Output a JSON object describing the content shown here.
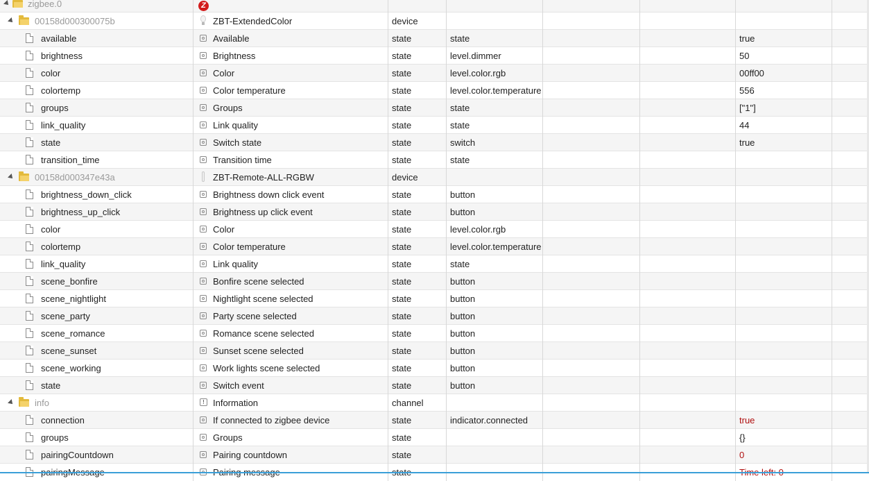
{
  "rows": [
    {
      "id": "zigbee.0",
      "level": 0,
      "kind": "folder",
      "muted": true,
      "icon": "adapter",
      "title": "",
      "type": "",
      "role": "",
      "value": "",
      "buttons": "del"
    },
    {
      "id": "00158d000300075b",
      "level": 1,
      "kind": "folder",
      "muted": true,
      "icon": "bulb",
      "title": "ZBT-ExtendedColor",
      "type": "device",
      "role": "",
      "value": "",
      "buttons": "both"
    },
    {
      "id": "available",
      "level": 2,
      "kind": "file",
      "icon": "state",
      "title": "Available",
      "type": "state",
      "role": "state",
      "value": "true",
      "buttons": "both"
    },
    {
      "id": "brightness",
      "level": 2,
      "kind": "file",
      "icon": "state",
      "title": "Brightness",
      "type": "state",
      "role": "level.dimmer",
      "value": "50",
      "buttons": "both"
    },
    {
      "id": "color",
      "level": 2,
      "kind": "file",
      "icon": "state",
      "title": "Color",
      "type": "state",
      "role": "level.color.rgb",
      "value": "00ff00",
      "buttons": "both"
    },
    {
      "id": "colortemp",
      "level": 2,
      "kind": "file",
      "icon": "state",
      "title": "Color temperature",
      "type": "state",
      "role": "level.color.temperature",
      "value": "556",
      "buttons": "both"
    },
    {
      "id": "groups",
      "level": 2,
      "kind": "file",
      "icon": "state",
      "title": "Groups",
      "type": "state",
      "role": "state",
      "value": "[\"1\"]",
      "buttons": "both"
    },
    {
      "id": "link_quality",
      "level": 2,
      "kind": "file",
      "icon": "state",
      "title": "Link quality",
      "type": "state",
      "role": "state",
      "value": "44",
      "buttons": "both"
    },
    {
      "id": "state",
      "level": 2,
      "kind": "file",
      "icon": "state",
      "title": "Switch state",
      "type": "state",
      "role": "switch",
      "value": "true",
      "buttons": "both"
    },
    {
      "id": "transition_time",
      "level": 2,
      "kind": "file",
      "icon": "state",
      "title": "Transition time",
      "type": "state",
      "role": "state",
      "value": "",
      "buttons": "both"
    },
    {
      "id": "00158d000347e43a",
      "level": 1,
      "kind": "folder",
      "muted": true,
      "icon": "remote",
      "title": "ZBT-Remote-ALL-RGBW",
      "type": "device",
      "role": "",
      "value": "",
      "buttons": "both"
    },
    {
      "id": "brightness_down_click",
      "level": 2,
      "kind": "file",
      "icon": "state",
      "title": "Brightness down click event",
      "type": "state",
      "role": "button",
      "value": "",
      "buttons": "both"
    },
    {
      "id": "brightness_up_click",
      "level": 2,
      "kind": "file",
      "icon": "state",
      "title": "Brightness up click event",
      "type": "state",
      "role": "button",
      "value": "",
      "buttons": "both"
    },
    {
      "id": "color",
      "level": 2,
      "kind": "file",
      "icon": "state",
      "title": "Color",
      "type": "state",
      "role": "level.color.rgb",
      "value": "",
      "buttons": "both"
    },
    {
      "id": "colortemp",
      "level": 2,
      "kind": "file",
      "icon": "state",
      "title": "Color temperature",
      "type": "state",
      "role": "level.color.temperature",
      "value": "",
      "buttons": "both"
    },
    {
      "id": "link_quality",
      "level": 2,
      "kind": "file",
      "icon": "state",
      "title": "Link quality",
      "type": "state",
      "role": "state",
      "value": "",
      "buttons": "both"
    },
    {
      "id": "scene_bonfire",
      "level": 2,
      "kind": "file",
      "icon": "state",
      "title": "Bonfire scene selected",
      "type": "state",
      "role": "button",
      "value": "",
      "buttons": "both"
    },
    {
      "id": "scene_nightlight",
      "level": 2,
      "kind": "file",
      "icon": "state",
      "title": "Nightlight scene selected",
      "type": "state",
      "role": "button",
      "value": "",
      "buttons": "both"
    },
    {
      "id": "scene_party",
      "level": 2,
      "kind": "file",
      "icon": "state",
      "title": "Party scene selected",
      "type": "state",
      "role": "button",
      "value": "",
      "buttons": "both"
    },
    {
      "id": "scene_romance",
      "level": 2,
      "kind": "file",
      "icon": "state",
      "title": "Romance scene selected",
      "type": "state",
      "role": "button",
      "value": "",
      "buttons": "both"
    },
    {
      "id": "scene_sunset",
      "level": 2,
      "kind": "file",
      "icon": "state",
      "title": "Sunset scene selected",
      "type": "state",
      "role": "button",
      "value": "",
      "buttons": "both"
    },
    {
      "id": "scene_working",
      "level": 2,
      "kind": "file",
      "icon": "state",
      "title": "Work lights scene selected",
      "type": "state",
      "role": "button",
      "value": "",
      "buttons": "both"
    },
    {
      "id": "state",
      "level": 2,
      "kind": "file",
      "icon": "state",
      "title": "Switch event",
      "type": "state",
      "role": "button",
      "value": "",
      "buttons": "both"
    },
    {
      "id": "info",
      "level": 1,
      "kind": "folder",
      "muted": true,
      "icon": "channel",
      "title": "Information",
      "type": "channel",
      "role": "",
      "value": "",
      "buttons": "both"
    },
    {
      "id": "connection",
      "level": 2,
      "kind": "file",
      "icon": "state",
      "title": "If connected to zigbee device",
      "type": "state",
      "role": "indicator.connected",
      "value": "true",
      "valueColor": "#b01010",
      "buttons": "both"
    },
    {
      "id": "groups",
      "level": 2,
      "kind": "file",
      "icon": "state",
      "title": "Groups",
      "type": "state",
      "role": "",
      "value": "{}",
      "buttons": "both"
    },
    {
      "id": "pairingCountdown",
      "level": 2,
      "kind": "file",
      "icon": "state",
      "title": "Pairing countdown",
      "type": "state",
      "role": "",
      "value": "0",
      "valueColor": "#b01010",
      "buttons": "both"
    },
    {
      "id": "pairingMessage",
      "level": 2,
      "kind": "file",
      "icon": "state",
      "title": "Pairing message",
      "type": "state",
      "role": "",
      "value": "Time left: 0",
      "valueColor": "#b01010",
      "buttons": "both"
    }
  ],
  "icons": {
    "adapter": "zigbee-adapter-icon",
    "bulb": "bulb-icon",
    "remote": "remote-icon",
    "channel": "info-icon",
    "state": "state-icon",
    "edit": "pencil-icon",
    "delete": "trash-icon"
  },
  "colors": {
    "folder": "#e3ba3c",
    "value_alert": "#b01010",
    "scroll_line": "#3a9fd8"
  }
}
